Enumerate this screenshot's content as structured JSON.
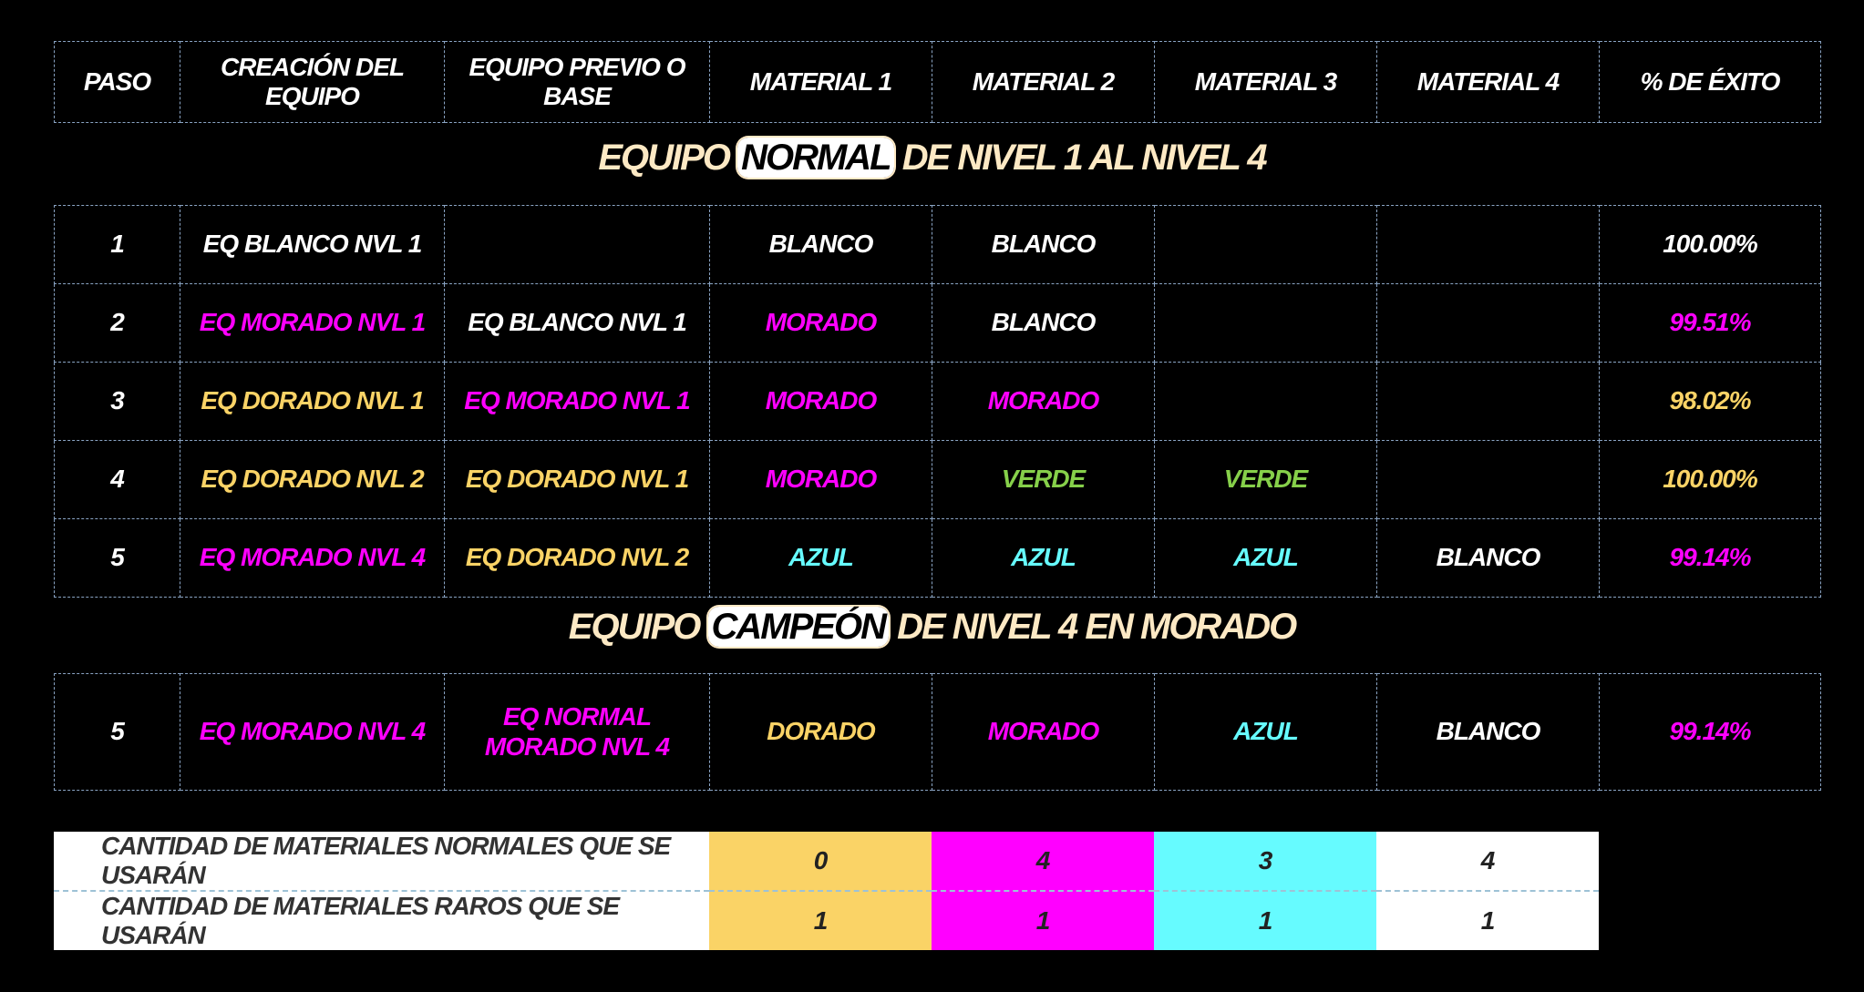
{
  "colors": {
    "white": "#ffffff",
    "purple": "#ff00ff",
    "gold": "#fad366",
    "green": "#86d04a",
    "cyan": "#66fbff",
    "title": "#fde9c4",
    "background": "#000000"
  },
  "header": [
    "PASO",
    "CREACIÓN DEL EQUIPO",
    "EQUIPO PREVIO O BASE",
    "MATERIAL 1",
    "MATERIAL 2",
    "MATERIAL 3",
    "MATERIAL 4",
    "% DE ÉXITO"
  ],
  "section1": {
    "pre": "EQUIPO",
    "highlight": "NORMAL",
    "post": "DE NIVEL 1 AL NIVEL 4"
  },
  "rows": [
    {
      "cells": [
        "1",
        "EQ BLANCO NVL 1",
        "",
        "BLANCO",
        "BLANCO",
        "",
        "",
        "100.00%"
      ],
      "colors": [
        "white",
        "white",
        "white",
        "white",
        "white",
        "white",
        "white",
        "white"
      ]
    },
    {
      "cells": [
        "2",
        "EQ MORADO NVL 1",
        "EQ BLANCO NVL 1",
        "MORADO",
        "BLANCO",
        "",
        "",
        "99.51%"
      ],
      "colors": [
        "white",
        "purple",
        "white",
        "purple",
        "white",
        "white",
        "white",
        "purple"
      ]
    },
    {
      "cells": [
        "3",
        "EQ DORADO NVL 1",
        "EQ MORADO NVL 1",
        "MORADO",
        "MORADO",
        "",
        "",
        "98.02%"
      ],
      "colors": [
        "white",
        "gold",
        "purple",
        "purple",
        "purple",
        "white",
        "white",
        "gold"
      ]
    },
    {
      "cells": [
        "4",
        "EQ DORADO NVL 2",
        "EQ DORADO NVL 1",
        "MORADO",
        "VERDE",
        "VERDE",
        "",
        "100.00%"
      ],
      "colors": [
        "white",
        "gold",
        "gold",
        "purple",
        "green",
        "green",
        "white",
        "gold"
      ]
    },
    {
      "cells": [
        "5",
        "EQ MORADO NVL 4",
        "EQ DORADO NVL 2",
        "AZUL",
        "AZUL",
        "AZUL",
        "BLANCO",
        "99.14%"
      ],
      "colors": [
        "white",
        "purple",
        "gold",
        "cyan",
        "cyan",
        "cyan",
        "white",
        "purple"
      ]
    }
  ],
  "section2": {
    "pre": "EQUIPO",
    "highlight": "CAMPEÓN",
    "post": "DE NIVEL 4 EN MORADO"
  },
  "champion_row": {
    "cells": [
      "5",
      "EQ MORADO NVL 4",
      "EQ NORMAL MORADO NVL 4",
      "DORADO",
      "MORADO",
      "AZUL",
      "BLANCO",
      "99.14%"
    ],
    "colors": [
      "white",
      "purple",
      "purple",
      "gold",
      "purple",
      "cyan",
      "white",
      "purple"
    ]
  },
  "summary": {
    "column_colors": [
      "#fad366",
      "#ff00ff",
      "#66fbff",
      "#ffffff"
    ],
    "rows": [
      {
        "label": "CANTIDAD DE MATERIALES NORMALES QUE SE USARÁN",
        "values": [
          "0",
          "4",
          "3",
          "4"
        ]
      },
      {
        "label": "CANTIDAD DE MATERIALES RAROS QUE SE USARÁN",
        "values": [
          "1",
          "1",
          "1",
          "1"
        ]
      }
    ]
  }
}
